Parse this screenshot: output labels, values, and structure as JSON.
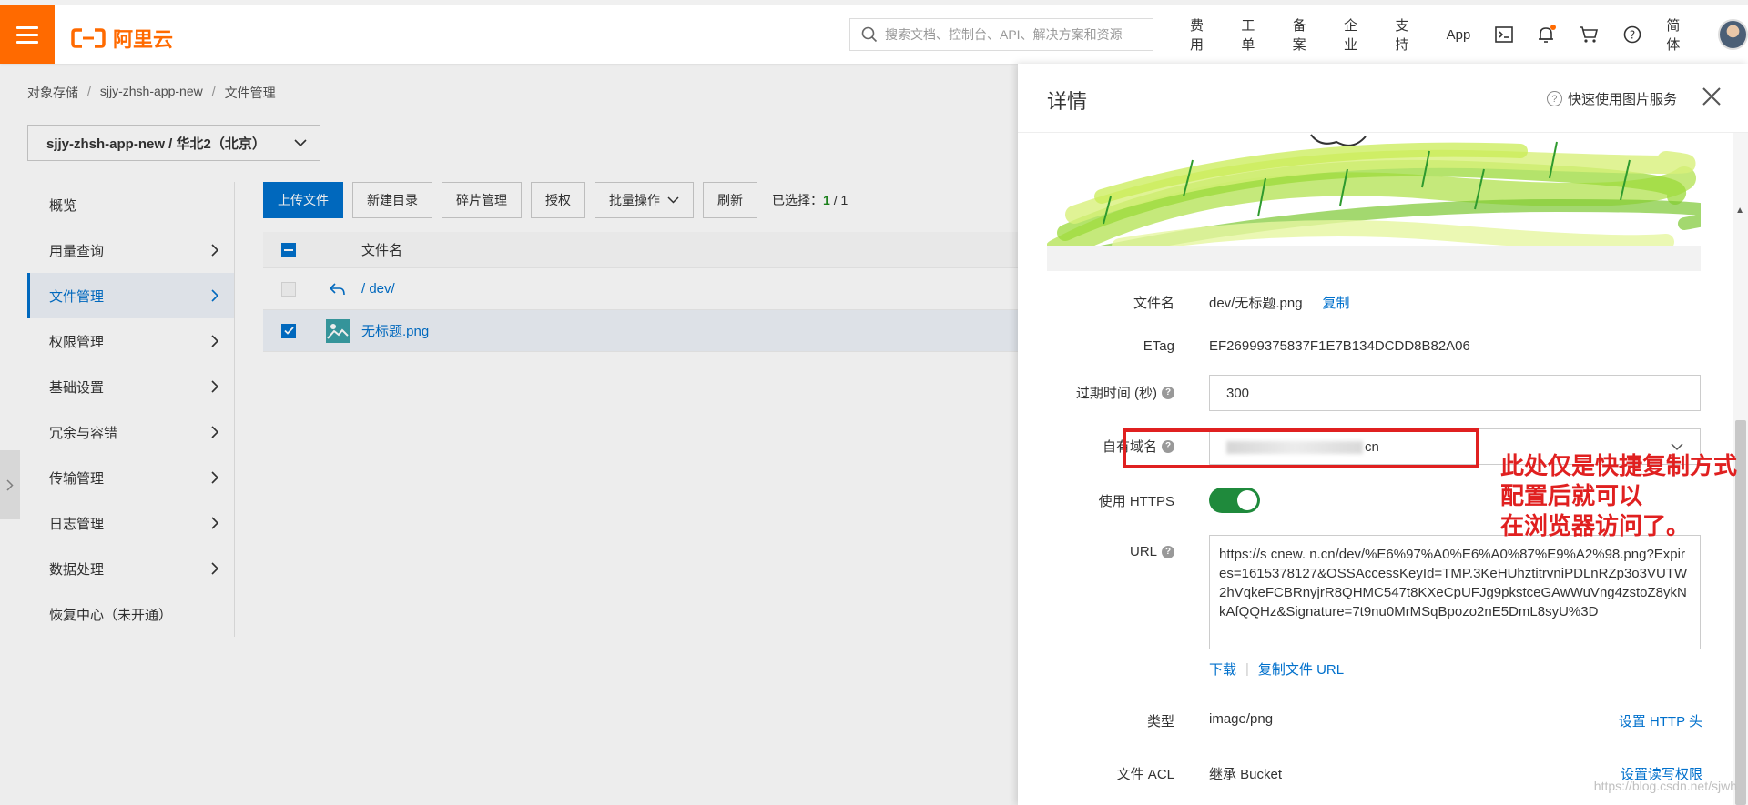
{
  "topbar": {
    "logo_text": "阿里云",
    "search_placeholder": "搜索文档、控制台、API、解决方案和资源",
    "nav": [
      "费用",
      "工单",
      "备案",
      "企业",
      "支持",
      "App"
    ],
    "lang": "简体"
  },
  "breadcrumb": [
    "对象存储",
    "sjjy-zhsh-app-new",
    "文件管理"
  ],
  "bucket_select": "sjjy-zhsh-app-new / 华北2（北京）",
  "sidebar": [
    {
      "label": "概览",
      "chevron": false
    },
    {
      "label": "用量查询",
      "chevron": true
    },
    {
      "label": "文件管理",
      "chevron": true,
      "active": true
    },
    {
      "label": "权限管理",
      "chevron": true
    },
    {
      "label": "基础设置",
      "chevron": true
    },
    {
      "label": "冗余与容错",
      "chevron": true
    },
    {
      "label": "传输管理",
      "chevron": true
    },
    {
      "label": "日志管理",
      "chevron": true
    },
    {
      "label": "数据处理",
      "chevron": true
    },
    {
      "label": "恢复中心（未开通）",
      "chevron": false
    }
  ],
  "toolbar": {
    "upload": "上传文件",
    "new_dir": "新建目录",
    "fragments": "碎片管理",
    "authorize": "授权",
    "batch": "批量操作",
    "refresh": "刷新",
    "selected_label": "已选择：",
    "selected_count": "1",
    "selected_total": "/ 1"
  },
  "file_table": {
    "header_name": "文件名",
    "rows": [
      {
        "name": "/ dev/"
      },
      {
        "name": "无标题.png",
        "selected": true
      }
    ]
  },
  "drawer": {
    "title": "详情",
    "quick_help": "快速使用图片服务",
    "fields": {
      "filename_label": "文件名",
      "filename_value": "dev/无标题.png",
      "copy_label": "复制",
      "etag_label": "ETag",
      "etag_value": "EF26999375837F1E7B134DCDD8B82A06",
      "expire_label": "过期时间 (秒)",
      "expire_value": "300",
      "domain_label": "自有域名",
      "domain_suffix": "cn",
      "https_label": "使用 HTTPS",
      "https_on": true,
      "url_label": "URL",
      "url_value": "https://s      cnew.         n.cn/dev/%E6%97%A0%E6%A0%87%E9%A2%98.png?Expires=1615378127&OSSAccessKeyId=TMP.3KeHUhztitrvniPDLnRZp3o3VUTW2hVqkeFCBRnyjrR8QHMC547t8KXeCpUFJg9pkstceGAwWuVng4zstoZ8ykNkAfQQHz&Signature=7t9nu0MrMSqBpozo2nE5DmL8syU%3D",
      "download_label": "下载",
      "copy_url_label": "复制文件 URL",
      "type_label": "类型",
      "type_value": "image/png",
      "http_header_label": "设置 HTTP 头",
      "acl_label": "文件 ACL",
      "acl_value": "继承 Bucket",
      "acl_link": "设置读写权限"
    }
  },
  "annotation": {
    "lines": [
      "此处仅是快捷复制方式",
      "配置后就可以",
      "在浏览器访问了。"
    ],
    "color": "#e02020"
  },
  "watermark": "https://blog.csdn.net/sjwh",
  "colors": {
    "brand": "#ff6a00",
    "primary": "#0070cc",
    "toggle_on": "#1f8a3c"
  }
}
